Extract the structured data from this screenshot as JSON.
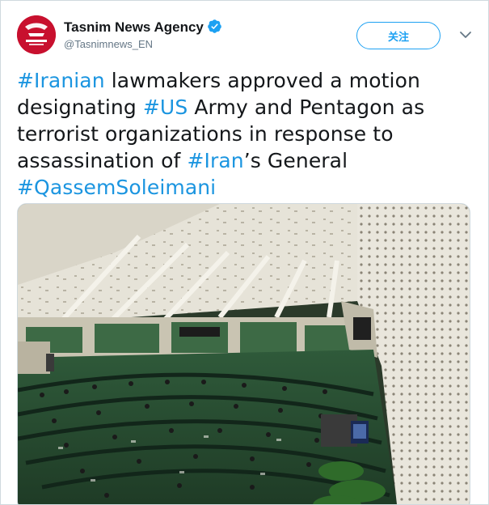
{
  "account": {
    "display_name": "Tasnim News Agency",
    "handle": "@Tasnimnews_EN",
    "verified": true,
    "avatar_icon": "tasnim-logo",
    "brand_color": "#c8102e"
  },
  "actions": {
    "follow_label": "关注",
    "menu_icon": "chevron-down-icon",
    "accent_color": "#1da1f2"
  },
  "tweet": {
    "line1_tag": "#Iranian",
    "line1_text": " lawmakers approved a motion",
    "line2_text": "designating ",
    "line2_tag": "#US",
    "line2_rest": " Army and Pentagon as",
    "line3_text": "terrorist organizations in response to",
    "line4_text": "assassination of ",
    "line4_tag": "#Iran",
    "line4_rest": "’s General",
    "line5_tag": "#QassemSoleimani",
    "hashtag_color": "#1b95e0"
  },
  "media": {
    "kind": "photo",
    "subject": "parliament-chamber"
  }
}
